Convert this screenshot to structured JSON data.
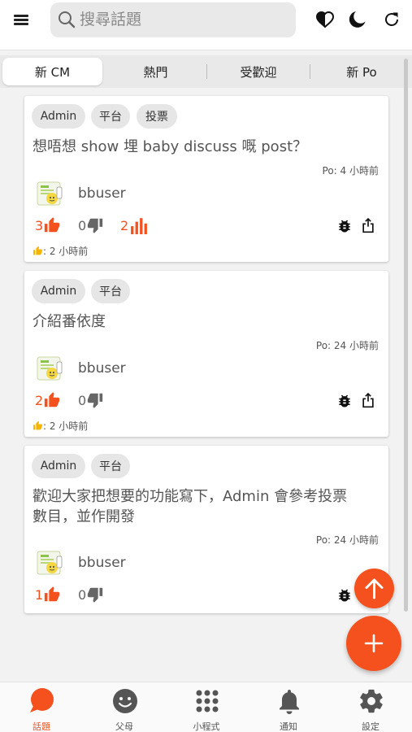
{
  "search": {
    "placeholder": "搜尋話題"
  },
  "tabs": [
    {
      "label": "新 CM",
      "active": true
    },
    {
      "label": "熱門",
      "active": false
    },
    {
      "label": "受歡迎",
      "active": false
    },
    {
      "label": "新 Po",
      "active": false
    }
  ],
  "posts": [
    {
      "tags": [
        "Admin",
        "平台",
        "投票"
      ],
      "title": "想唔想 show 埋 baby discuss 嘅 post？",
      "posted": "Po: 4 小時前",
      "user": "bbuser",
      "likes": "3",
      "dislikes": "0",
      "votes": "2",
      "last_like": ": 2 小時前"
    },
    {
      "tags": [
        "Admin",
        "平台"
      ],
      "title": "介紹番依度",
      "posted": "Po: 24 小時前",
      "user": "bbuser",
      "likes": "2",
      "dislikes": "0",
      "last_like": ": 2 小時前"
    },
    {
      "tags": [
        "Admin",
        "平台"
      ],
      "title_lines": [
        "歡迎大家把想要的功能寫下，Admin 會參考投票",
        "數目，並作開發"
      ],
      "posted": "Po: 24 小時前",
      "user": "bbuser",
      "likes": "1",
      "dislikes": "0"
    }
  ],
  "bottom_nav": [
    {
      "label": "話題",
      "icon": "chat-bubble-icon",
      "active": true
    },
    {
      "label": "父母",
      "icon": "smiley-icon",
      "active": false
    },
    {
      "label": "小程式",
      "icon": "apps-grid-icon",
      "active": false
    },
    {
      "label": "通知",
      "icon": "bell-icon",
      "active": false
    },
    {
      "label": "設定",
      "icon": "gear-icon",
      "active": false
    }
  ],
  "colors": {
    "accent": "#f4511e",
    "chip_bg": "#e6e6e6",
    "background": "#f2f2f2"
  }
}
